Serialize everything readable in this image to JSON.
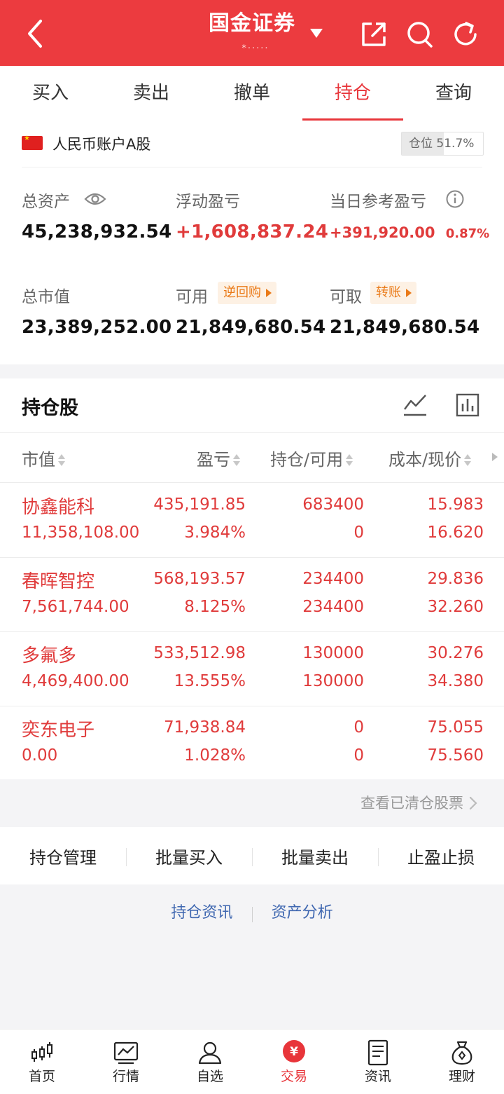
{
  "header": {
    "title": "国金证券",
    "account_mask": "*·····",
    "icons": [
      "back-icon",
      "dropdown-caret-icon",
      "share-icon",
      "search-icon",
      "refresh-icon"
    ]
  },
  "tabs": [
    {
      "label": "买入"
    },
    {
      "label": "卖出"
    },
    {
      "label": "撤单"
    },
    {
      "label": "持仓",
      "active": true
    },
    {
      "label": "查询"
    }
  ],
  "account": {
    "name": "人民币账户A股",
    "position_label": "仓位",
    "position_value": "51.7%",
    "position_ratio": 0.517
  },
  "metrics": {
    "total_assets_label": "总资产",
    "total_assets": "45,238,932.54",
    "floating_pl_label": "浮动盈亏",
    "floating_pl": "+1,608,837.24",
    "daily_pl_label": "当日参考盈亏",
    "daily_pl": "+391,920.00",
    "daily_pl_pct": "0.87%",
    "market_value_label": "总市值",
    "market_value": "23,389,252.00",
    "available_label": "可用",
    "reverse_repo_tag": "逆回购",
    "available": "21,849,680.54",
    "withdrawable_label": "可取",
    "transfer_tag": "转账",
    "withdrawable": "21,849,680.54"
  },
  "holdings": {
    "title": "持仓股",
    "columns": [
      "市值",
      "盈亏",
      "持仓/可用",
      "成本/现价"
    ],
    "rows": [
      {
        "name": "协鑫能科",
        "market_value": "11,358,108.00",
        "pl": "435,191.85",
        "pl_pct": "3.984%",
        "position": "683400",
        "available": "0",
        "cost": "15.983",
        "price": "16.620"
      },
      {
        "name": "春晖智控",
        "market_value": "7,561,744.00",
        "pl": "568,193.57",
        "pl_pct": "8.125%",
        "position": "234400",
        "available": "234400",
        "cost": "29.836",
        "price": "32.260"
      },
      {
        "name": "多氟多",
        "market_value": "4,469,400.00",
        "pl": "533,512.98",
        "pl_pct": "13.555%",
        "position": "130000",
        "available": "130000",
        "cost": "30.276",
        "price": "34.380"
      },
      {
        "name": "奕东电子",
        "market_value": "0.00",
        "pl": "71,938.84",
        "pl_pct": "1.028%",
        "position": "0",
        "available": "0",
        "cost": "75.055",
        "price": "75.560"
      }
    ],
    "cleared_link": "查看已清仓股票"
  },
  "actions": [
    "持仓管理",
    "批量买入",
    "批量卖出",
    "止盈止损"
  ],
  "links": [
    "持仓资讯",
    "资产分析"
  ],
  "bottom_nav": [
    {
      "label": "首页",
      "icon": "candlestick-icon"
    },
    {
      "label": "行情",
      "icon": "chart-icon"
    },
    {
      "label": "自选",
      "icon": "user-icon"
    },
    {
      "label": "交易",
      "icon": "yuan-icon",
      "active": true
    },
    {
      "label": "资讯",
      "icon": "news-icon"
    },
    {
      "label": "理财",
      "icon": "money-bag-icon"
    }
  ],
  "colors": {
    "brand": "#ec3b3f",
    "up": "#e03b3b",
    "tag": "#ea7a18",
    "link": "#3f67b0"
  }
}
